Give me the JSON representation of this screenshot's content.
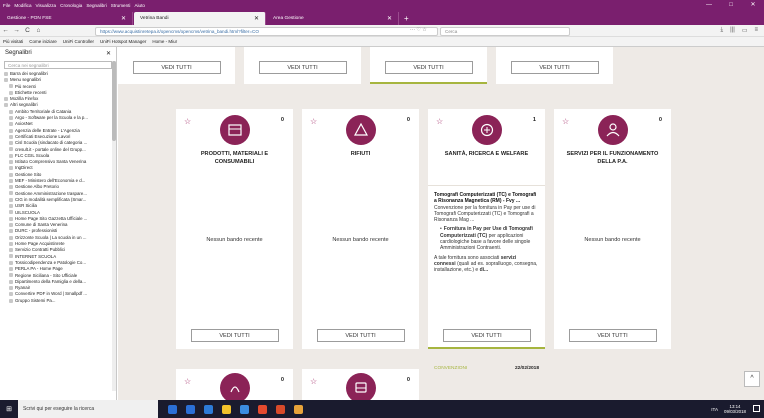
{
  "menubar": {
    "items": [
      "File",
      "Modifica",
      "Visualizza",
      "Cronologia",
      "Segnalibri",
      "Strumenti",
      "Aiuto"
    ],
    "controls": [
      "—",
      "□",
      "✕"
    ]
  },
  "tabs": [
    {
      "label": "Gestione - PON FSE",
      "close": "✕"
    },
    {
      "label": "Vetrina Bandi",
      "close": "✕"
    },
    {
      "label": "Area Gestione",
      "close": "✕"
    }
  ],
  "newtab": "+",
  "nav": {
    "back": "←",
    "forward": "→",
    "reload": "C",
    "home": "⌂",
    "url": "https://www.acquistinretepa.it/opencms/opencms/vetrina_bandi.html?filter=CO",
    "url_icons": "··· ♡ ☆",
    "search_placeholder": "Cerca",
    "right_icons": [
      "⤓",
      "|||",
      "▭",
      "≡"
    ]
  },
  "bookmarks": [
    "Più visitati",
    "Come iniziare",
    "UniFi Controller",
    "UniFi Hotspot Manager",
    "Home - Miur"
  ],
  "sidebar": {
    "title": "Segnalibri",
    "close": "✕",
    "search_placeholder": "Cerca nei segnalibri",
    "items": [
      {
        "label": "Barra dei segnalibri",
        "level": "l0"
      },
      {
        "label": "Menu segnalibri",
        "level": "l0"
      },
      {
        "label": "Più recenti",
        "level": "l1"
      },
      {
        "label": "Etichette recenti",
        "level": "l1"
      },
      {
        "label": "Mozilla Firefox",
        "level": "l0"
      },
      {
        "label": "Altri segnalibri",
        "level": "l0"
      },
      {
        "label": "Ambito Territoriale di Catania",
        "level": "l1"
      },
      {
        "label": "Argo - Software per la Scuola e la p...",
        "level": "l1"
      },
      {
        "label": "AxiosNet",
        "level": "l1"
      },
      {
        "label": "Agenzia delle Entrate - L'Agenzia",
        "level": "l1"
      },
      {
        "label": "Certificati Esecuzione Lavori",
        "level": "l1"
      },
      {
        "label": "Cisl Scuola (sindacato di categoria ...",
        "level": "l1"
      },
      {
        "label": "cresult.it - portale online del Grupp...",
        "level": "l1"
      },
      {
        "label": "FLC CGIL Scuola",
        "level": "l1"
      },
      {
        "label": "Istituto Comprensivo Santa Venerina",
        "level": "l1"
      },
      {
        "label": "IngDirect",
        "level": "l1"
      },
      {
        "label": "Gestione Sito",
        "level": "l1"
      },
      {
        "label": "MEF - Ministero dell'Economia e d...",
        "level": "l1"
      },
      {
        "label": "Gestione Albo Pretorio",
        "level": "l1"
      },
      {
        "label": "Gestione Amministrazione traspare...",
        "level": "l1"
      },
      {
        "label": "CIG in modalità semplificata (Smar...",
        "level": "l1"
      },
      {
        "label": "USR Sicilia",
        "level": "l1"
      },
      {
        "label": "UILSCUOLA",
        "level": "l1"
      },
      {
        "label": "Home Page Sito Gazzetta Ufficiale ...",
        "level": "l1"
      },
      {
        "label": "Comune di Santa Venerina",
        "level": "l1"
      },
      {
        "label": "DURC - professionisti",
        "level": "l1"
      },
      {
        "label": "Orizzonte Scuola | La scuola in un ...",
        "level": "l1"
      },
      {
        "label": "Home Page Acquistinrete",
        "level": "l1"
      },
      {
        "label": "Servizio Contratti Pubblici",
        "level": "l1"
      },
      {
        "label": "INTERNET SCUOLA",
        "level": "l1"
      },
      {
        "label": "Tossicodipendenza e Patologie Co...",
        "level": "l1"
      },
      {
        "label": "PERLA PA - Home Page",
        "level": "l1"
      },
      {
        "label": "Regione Siciliana - Sito Ufficiale",
        "level": "l1"
      },
      {
        "label": "Dipartimento della Famiglia e della...",
        "level": "l1"
      },
      {
        "label": "Ryanair",
        "level": "l1"
      },
      {
        "label": "Convertire PDF in Word | Smallpdf ...",
        "level": "l1"
      },
      {
        "label": "Gruppo Sistemi Pa...",
        "level": "l1"
      }
    ]
  },
  "cards_top": {
    "button": "VEDI TUTTI"
  },
  "cards": [
    {
      "title": "PRODOTTI, MATERIALI E CONSUMABILI",
      "count": "0",
      "empty": "Nessun bando recente",
      "button": "VEDI TUTTI"
    },
    {
      "title": "RIFIUTI",
      "count": "0",
      "empty": "Nessun bando recente",
      "button": "VEDI TUTTI"
    },
    {
      "title": "SANITÀ, RICERCA E WELFARE",
      "count": "1",
      "button": "VEDI TUTTI"
    },
    {
      "title": "SERVIZI PER IL FUNZIONAMENTO DELLA P.A.",
      "count": "0",
      "empty": "Nessun bando recente",
      "button": "VEDI TUTTI"
    }
  ],
  "bando": {
    "title": "Tomografi Computerizzati (TC) e Tomografi a Risonanza Magnetica (RM) - Fvy ...",
    "desc": "Convenzione per la fornitura in Pay per use di Tomografi Computerizzati (TC) e Tomografi a Risonanza Mag ...",
    "bullet_bold": "Fornitura in Pay per Use di Tomografi Computerizzati (TC)",
    "bullet_rest": " per applicazioni cardiologiche base a favore delle singole Amministrazioni Contraenti.",
    "para_a": "A tale fornitura sono associati ",
    "para_bold": "servizi connessi",
    "para_b": " (quali ad es. sopralluogo, consegna, installazione, etc.) e ",
    "para_end": "di...",
    "category": "CONVENZIONI",
    "date": "22/02/2018"
  },
  "bottom_cards": [
    {
      "count": "0"
    },
    {
      "count": "0"
    }
  ],
  "scroll_top": "^",
  "taskbar": {
    "search": "Scrivi qui per eseguire la ricerca",
    "tray": "ITA",
    "time": "13:14",
    "date": "09/03/2018"
  },
  "colors": {
    "accent": "#8b2357",
    "menubar": "#7a1f6e",
    "highlight": "#a6b53f",
    "background": "#eeeae6"
  }
}
